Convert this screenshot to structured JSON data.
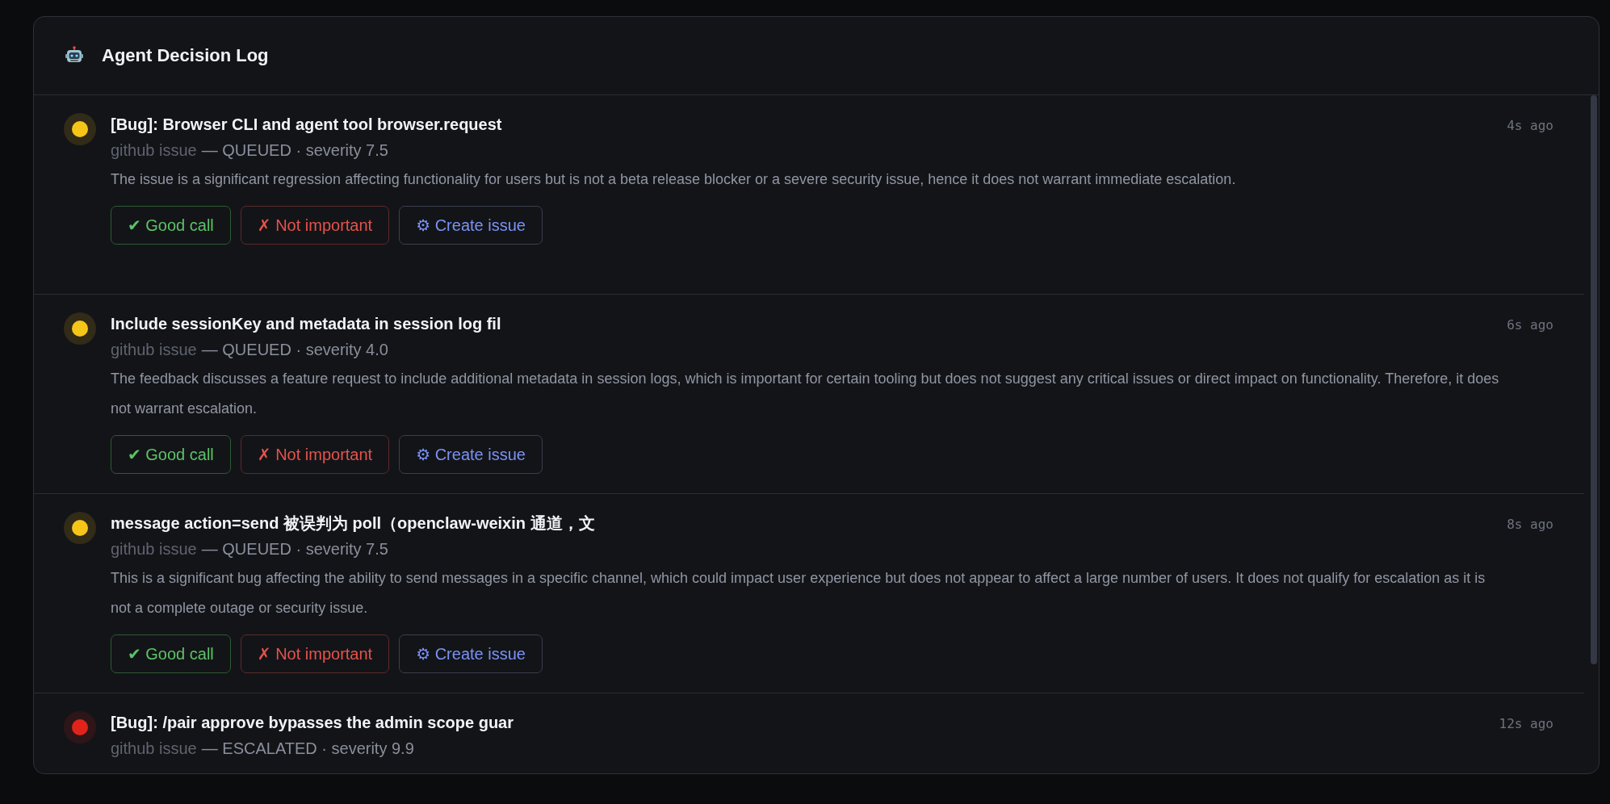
{
  "panel": {
    "title": "Agent Decision Log"
  },
  "entries": [
    {
      "color": "#f5c518",
      "title": "[Bug]: Browser CLI and agent tool browser.request",
      "source": "github issue",
      "detail": "— QUEUED · severity 7.5",
      "time": "4s ago",
      "description": "The issue is a significant regression affecting functionality for users but is not a beta release blocker or a severe security issue, hence it does not warrant immediate escalation.",
      "actions": [
        {
          "kind": "approve",
          "icon": "✔",
          "label": "Good call"
        },
        {
          "kind": "reject",
          "icon": "✗",
          "label": "Not important"
        },
        {
          "kind": "create",
          "icon": "⚙",
          "label": "Create issue"
        }
      ]
    },
    {
      "color": "#f5c518",
      "title": "Include sessionKey and metadata in session log fil",
      "source": "github issue",
      "detail": "— QUEUED · severity 4.0",
      "time": "6s ago",
      "description": "The feedback discusses a feature request to include additional metadata in session logs, which is important for certain tooling but does not suggest any critical issues or direct impact on functionality. Therefore, it does not warrant escalation.",
      "actions": [
        {
          "kind": "approve",
          "icon": "✔",
          "label": "Good call"
        },
        {
          "kind": "reject",
          "icon": "✗",
          "label": "Not important"
        },
        {
          "kind": "create",
          "icon": "⚙",
          "label": "Create issue"
        }
      ]
    },
    {
      "color": "#f5c518",
      "title": "message action=send 被误判为 poll（openclaw-weixin 通道，文",
      "source": "github issue",
      "detail": "— QUEUED · severity 7.5",
      "time": "8s ago",
      "description": "This is a significant bug affecting the ability to send messages in a specific channel, which could impact user experience but does not appear to affect a large number of users. It does not qualify for escalation as it is not a complete outage or security issue.",
      "actions": [
        {
          "kind": "approve",
          "icon": "✔",
          "label": "Good call"
        },
        {
          "kind": "reject",
          "icon": "✗",
          "label": "Not important"
        },
        {
          "kind": "create",
          "icon": "⚙",
          "label": "Create issue"
        }
      ]
    },
    {
      "color": "#e0241b",
      "title": "[Bug]: /pair approve bypasses the admin scope guar",
      "source": "github issue",
      "detail": "— ESCALATED · severity 9.9",
      "time": "12s ago"
    }
  ]
}
